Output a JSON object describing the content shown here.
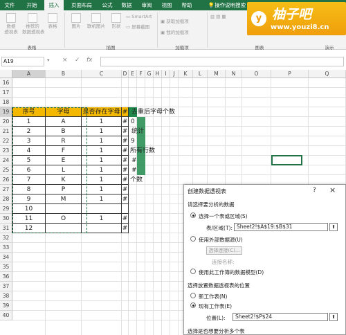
{
  "tabs": [
    "文件",
    "开始",
    "插入",
    "页面布局",
    "公式",
    "数据",
    "审阅",
    "视图",
    "帮助",
    "操作说明搜索"
  ],
  "ribbon": {
    "tables": [
      {
        "icon": "pivot-table-icon",
        "label": "数据\n透视表"
      },
      {
        "icon": "recommended-pivot-icon",
        "label": "推荐的\n数据透视表"
      },
      {
        "icon": "table-icon",
        "label": "表格"
      }
    ],
    "illustrations": [
      {
        "icon": "picture-icon",
        "label": "图片"
      },
      {
        "icon": "online-picture-icon",
        "label": "联机图片"
      },
      {
        "icon": "shapes-icon",
        "label": "形状"
      }
    ],
    "smartart": "SmartArt",
    "screenshot": "屏幕截图",
    "addins": [
      "获取加载项",
      "我的加载项"
    ],
    "groups": [
      "表格",
      "插图",
      "加载项",
      "图表",
      "演示"
    ]
  },
  "logo": {
    "title": "柚子吧",
    "url": "www.youzi8.cn",
    "mark": "y"
  },
  "namebox": "A19",
  "formula_buttons": [
    "×",
    "✓",
    "fx"
  ],
  "columns": [
    "A",
    "B",
    "C",
    "D",
    "E",
    "F",
    "G",
    "H",
    "I",
    "J",
    "K",
    "L",
    "M",
    "N",
    "O",
    "P",
    "Q"
  ],
  "rows": [
    "16",
    "17",
    "18",
    "19",
    "20",
    "21",
    "22",
    "23",
    "24",
    "25",
    "26",
    "27",
    "28",
    "29",
    "30",
    "31",
    "32",
    "33",
    "34",
    "35",
    "36",
    "37",
    "38",
    "39",
    "40"
  ],
  "table": {
    "headers": [
      "序号",
      "字母",
      "是否存在字母",
      "#"
    ],
    "rows": [
      [
        "1",
        "A",
        "1",
        "#"
      ],
      [
        "2",
        "B",
        "1",
        "#"
      ],
      [
        "3",
        "R",
        "1",
        "#"
      ],
      [
        "4",
        "F",
        "1",
        "#"
      ],
      [
        "5",
        "E",
        "1",
        "#"
      ],
      [
        "6",
        "L",
        "1",
        "#"
      ],
      [
        "7",
        "K",
        "1",
        "#"
      ],
      [
        "8",
        "P",
        "1",
        "#"
      ],
      [
        "9",
        "M",
        "1",
        "#"
      ],
      [
        "10",
        "",
        "",
        ""
      ],
      [
        "11",
        "O",
        "1",
        "#"
      ],
      [
        "12",
        "",
        "",
        "#"
      ]
    ]
  },
  "side_labels": [
    "去重后字母个数",
    "0",
    "统计",
    "9",
    "所有行数",
    "#",
    "#",
    "个数"
  ],
  "dialog": {
    "title": "创建数据透视表",
    "help": "?",
    "close": "×",
    "section1": "请选择要分析的数据",
    "opt_select_range": "选择一个表或区域(S)",
    "range_label": "表/区域(T):",
    "range_value": "Sheet2!$A$19:$B$31",
    "opt_external": "使用外部数据源(U)",
    "choose_connection": "选择连接(C)...",
    "connection_name": "连接名称:",
    "opt_data_model": "使用此工作簿的数据模型(D)",
    "section2": "选择放置数据透视表的位置",
    "opt_new_sheet": "新工作表(N)",
    "opt_existing_sheet": "现有工作表(E)",
    "location_label": "位置(L):",
    "location_value": "Sheet2!$P$24",
    "section3": "选择是否想要分析多个表"
  }
}
